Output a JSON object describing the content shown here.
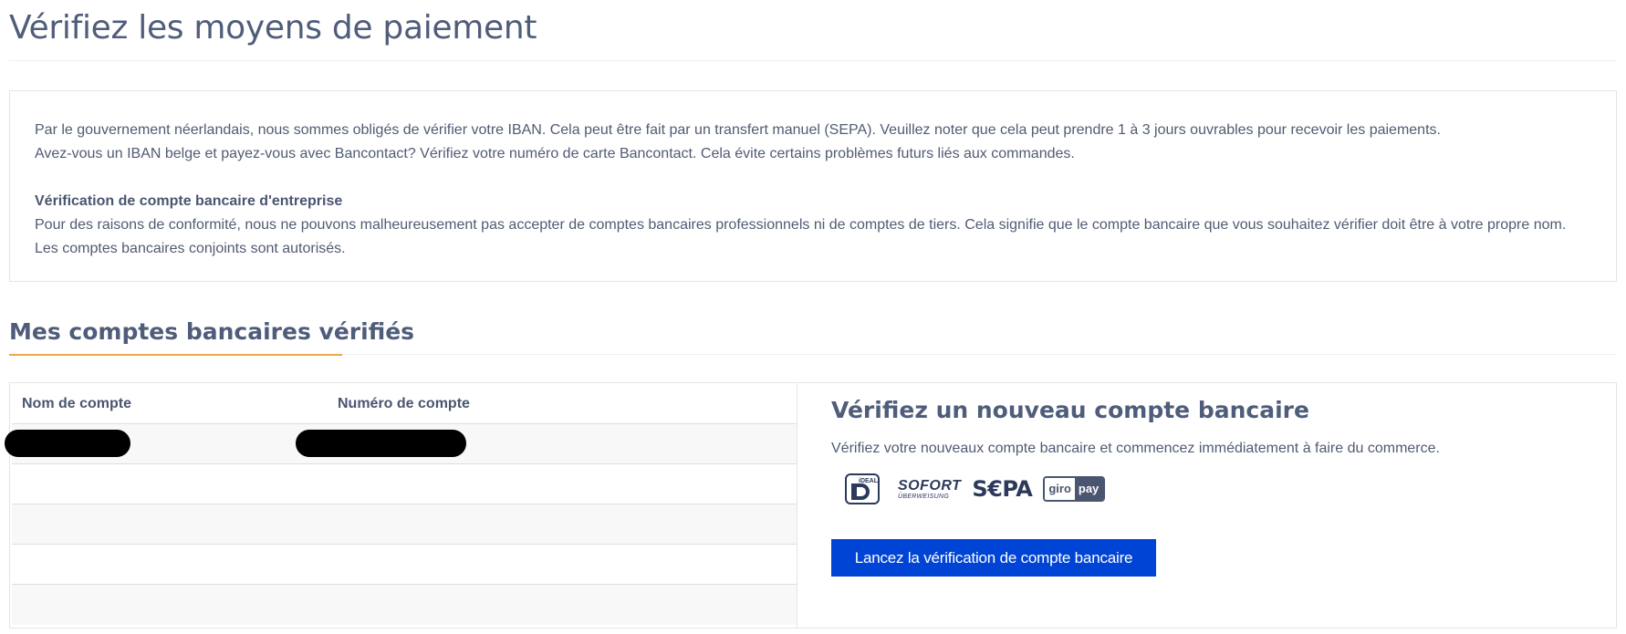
{
  "page": {
    "title": "Vérifiez les moyens de paiement"
  },
  "info": {
    "line1": "Par le gouvernement néerlandais, nous sommes obligés de vérifier votre IBAN. Cela peut être fait par un transfert manuel (SEPA). Veuillez noter que cela peut prendre 1 à 3 jours ouvrables pour recevoir les paiements.",
    "line2": "Avez-vous un IBAN belge et payez-vous avec Bancontact? Vérifiez votre numéro de carte Bancontact. Cela évite certains problèmes futurs liés aux commandes.",
    "business_heading": "Vérification de compte bancaire d'entreprise",
    "business_line1": "Pour des raisons de conformité, nous ne pouvons malheureusement pas accepter de comptes bancaires professionnels ni de comptes de tiers. Cela signifie que le compte bancaire que vous souhaitez vérifier doit être à votre propre nom.",
    "business_line2": "Les comptes bancaires conjoints sont autorisés."
  },
  "accounts": {
    "section_title": "Mes comptes bancaires vérifiés",
    "columns": [
      "Nom de compte",
      "Numéro de compte"
    ],
    "rows": [
      {
        "name": "",
        "number": "",
        "redacted": true
      },
      {
        "name": "",
        "number": ""
      },
      {
        "name": "",
        "number": ""
      },
      {
        "name": "",
        "number": ""
      },
      {
        "name": "",
        "number": ""
      }
    ]
  },
  "verify": {
    "title": "Vérifiez un nouveau compte bancaire",
    "description": "Vérifiez votre nouveaux compte bancaire et commencez immédiatement à faire du commerce.",
    "logos": {
      "ideal": "iDEAL",
      "sofort": "SOFORT",
      "sofort_sub": "ÜBERWEISUNG",
      "sepa": "S€PA",
      "giro_left": "giro",
      "giro_right": "pay"
    },
    "button_label": "Lancez la vérification de compte bancaire",
    "button_color": "#0044d6"
  },
  "colors": {
    "accent_underline": "#f0a64a",
    "title_text": "#4f5d7b"
  }
}
